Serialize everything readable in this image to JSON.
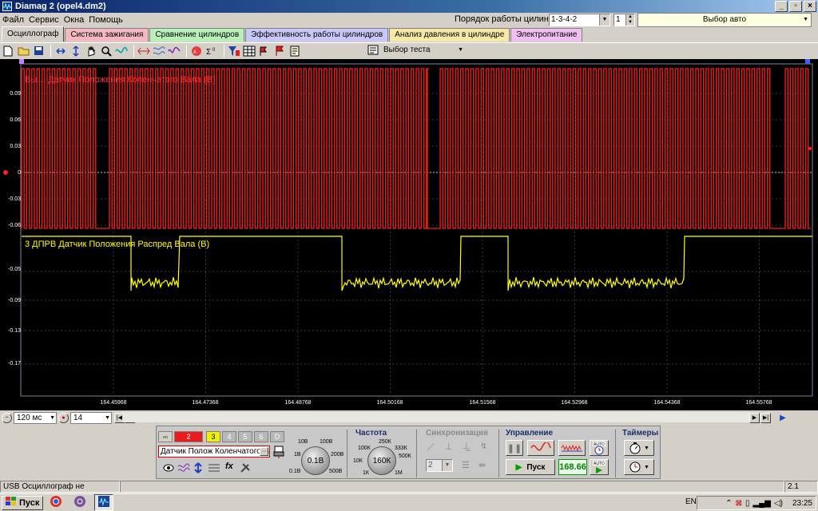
{
  "window": {
    "title": "Diamag 2 (opel4.dm2)",
    "minimize": "_",
    "restore": "▫",
    "close": "×"
  },
  "menu": [
    "Файл",
    "Сервис",
    "Окна",
    "Помощь"
  ],
  "header": {
    "cylinder_order_label": "Порядок работы цилиндров",
    "cylinder_order_value": "1-3-4-2",
    "cylinder_number": "1",
    "select_car_label": "Выбор авто"
  },
  "tabs": [
    {
      "label": "Осциллограф",
      "color": "#d4d0c8"
    },
    {
      "label": "Система зажигания",
      "color": "#f4b8c0"
    },
    {
      "label": "Сравнение цилиндров",
      "color": "#b8f0b8"
    },
    {
      "label": "Эффективность работы цилиндров",
      "color": "#c8c8f8"
    },
    {
      "label": "Анализ давления в цилиндре",
      "color": "#f8e8a8"
    },
    {
      "label": "Электропитание",
      "color": "#f0c0f0"
    }
  ],
  "toolbar": {
    "test_select_label": "Выбор теста"
  },
  "scope": {
    "channel1_label": "Вы… Датчик Положения Коленчатого Вала (В)",
    "channel2_label": "3 ДПРВ Датчик Положения Распред Вала (В)",
    "y_labels": [
      "0.09",
      "0.06",
      "0.03",
      "0",
      "-0.03",
      "-0.06",
      "-0.05",
      "-0.09",
      "-0.13",
      "-0.17"
    ],
    "x_labels": [
      "164.45968",
      "164.47368",
      "164.48768",
      "164.50168",
      "164.51568",
      "164.52968",
      "164.54368",
      "164.55768"
    ],
    "colors": {
      "channel1": "#ff1a1a",
      "channel2": "#ffff00",
      "grid": "#3a3a3a"
    }
  },
  "timebase": {
    "value": "120 мс",
    "pos_value": "14"
  },
  "panel": {
    "channels": [
      "1",
      "2",
      "3",
      "4",
      "5",
      "6",
      "D"
    ],
    "sensor_name": "Датчик Полож Коленчатого Вала",
    "voltage_knob": {
      "value": "0.1В",
      "labels": [
        "10В",
        "100В",
        "1В",
        "200В",
        "0.1В",
        "500В"
      ]
    },
    "frequency_title": "Частота",
    "frequency_knob": {
      "value": "160К",
      "labels": [
        "250К",
        "100К",
        "333К",
        "10К",
        "500К",
        "1К",
        "1М"
      ]
    },
    "sync_title": "Синхронизация",
    "sync_value": "2",
    "control_title": "Управление",
    "start_label": "Пуск",
    "rpm_value": "168.66",
    "timers_title": "Таймеры",
    "auto_label": "AUTO"
  },
  "status": {
    "text": "USB Осциллограф не подключен",
    "right": "2.1"
  },
  "taskbar": {
    "start_label": "Пуск",
    "lang": "EN",
    "clock": "23:25"
  }
}
